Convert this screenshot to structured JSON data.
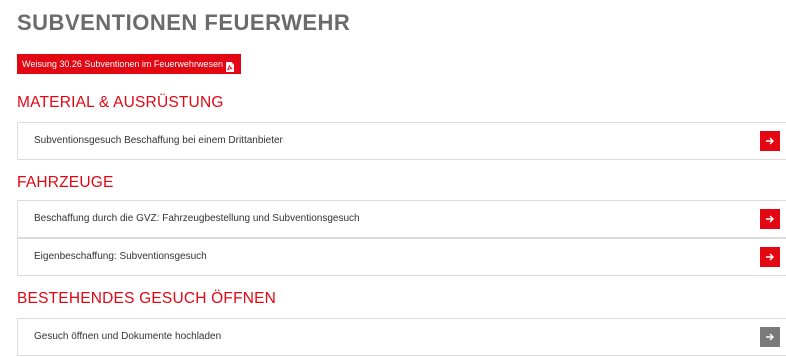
{
  "page": {
    "title": "SUBVENTIONEN FEUERWEHR"
  },
  "doc_link": {
    "label": "Weisung 30.26 Subventionen im Feuerwehrwesen",
    "icon": "pdf-icon"
  },
  "sections": [
    {
      "title": "MATERIAL & AUSRÜSTUNG",
      "rows": [
        {
          "label": "Subventionsgesuch Beschaffung bei einem Drittanbieter",
          "icon": "arrow-right-icon"
        }
      ]
    },
    {
      "title": "FAHRZEUGE",
      "rows": [
        {
          "label": "Beschaffung durch die GVZ: Fahrzeugbestellung und Subventionsgesuch",
          "icon": "arrow-right-icon"
        },
        {
          "label": "Eigenbeschaffung: Subventionsgesuch",
          "icon": "arrow-right-icon"
        }
      ]
    },
    {
      "title": "BESTEHENDES GESUCH ÖFFNEN",
      "rows": [
        {
          "label": "Gesuch öffnen und Dokumente hochladen",
          "icon": "arrow-right-icon"
        }
      ]
    }
  ],
  "colors": {
    "accent": "#e30613",
    "title_grey": "#6b6b6b",
    "arrow_grey": "#7a7a7a",
    "border": "#dcdcdc"
  }
}
